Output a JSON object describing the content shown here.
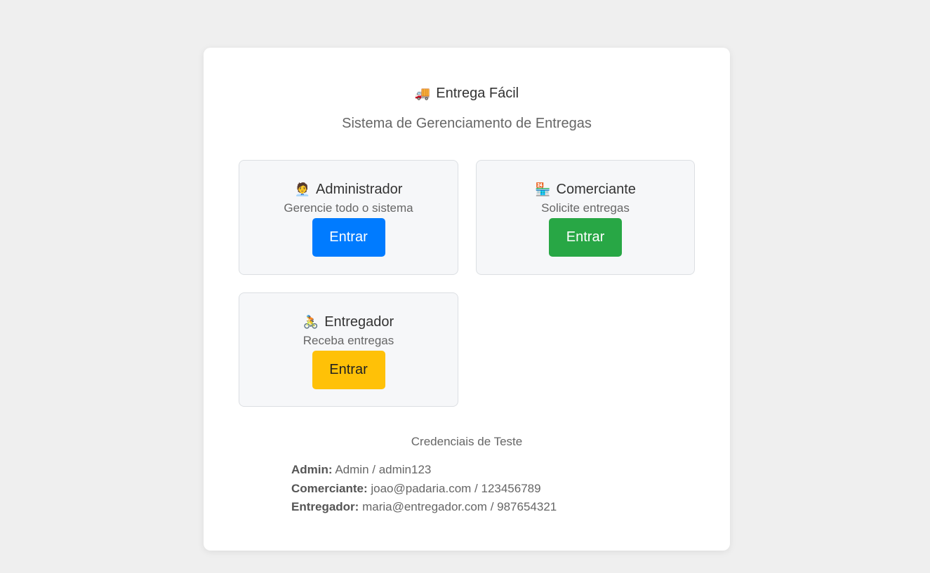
{
  "app": {
    "title": "Entrega Fácil",
    "title_icon": "delivery-truck-icon",
    "subtitle": "Sistema de Gerenciamento de Entregas"
  },
  "roles": [
    {
      "title": "Administrador",
      "icon": "businessman-icon",
      "description": "Gerencie todo o sistema",
      "button_label": "Entrar",
      "button_color": "#007bff"
    },
    {
      "title": "Comerciante",
      "icon": "store-icon",
      "description": "Solicite entregas",
      "button_label": "Entrar",
      "button_color": "#28a745"
    },
    {
      "title": "Entregador",
      "icon": "cyclist-icon",
      "description": "Receba entregas",
      "button_label": "Entrar",
      "button_color": "#ffc107"
    }
  ],
  "credentials": {
    "title": "Credenciais de Teste",
    "items": [
      {
        "label": "Admin:",
        "value": "Admin / admin123"
      },
      {
        "label": "Comerciante:",
        "value": "joao@padaria.com / 123456789"
      },
      {
        "label": "Entregador:",
        "value": "maria@entregador.com / 987654321"
      }
    ]
  },
  "colors": {
    "page_background": "#efefef",
    "card_background": "#ffffff",
    "role_card_background": "#f6f7f9"
  }
}
